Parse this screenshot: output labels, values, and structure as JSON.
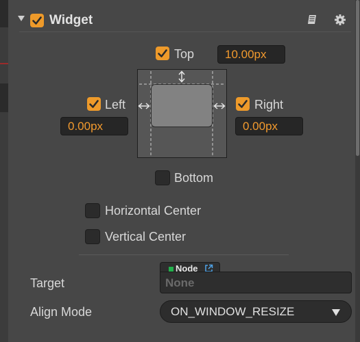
{
  "component": {
    "title": "Widget",
    "enabled": true,
    "help_icon": "book-icon",
    "settings_icon": "gear-icon"
  },
  "top": {
    "label": "Top",
    "checked": true,
    "value": "10.00px"
  },
  "left": {
    "label": "Left",
    "checked": true,
    "value": "0.00px"
  },
  "right": {
    "label": "Right",
    "checked": true,
    "value": "0.00px"
  },
  "bottom": {
    "label": "Bottom",
    "checked": false
  },
  "horizontal_center": {
    "label": "Horizontal Center",
    "checked": false
  },
  "vertical_center": {
    "label": "Vertical Center",
    "checked": false
  },
  "target": {
    "label": "Target",
    "type_tag": "Node",
    "value": "None"
  },
  "align_mode": {
    "label": "Align Mode",
    "value": "ON_WINDOW_RESIZE"
  },
  "colors": {
    "accent": "#ee9a2a",
    "value_text": "#f29a2e",
    "node_dot": "#22b14c"
  }
}
